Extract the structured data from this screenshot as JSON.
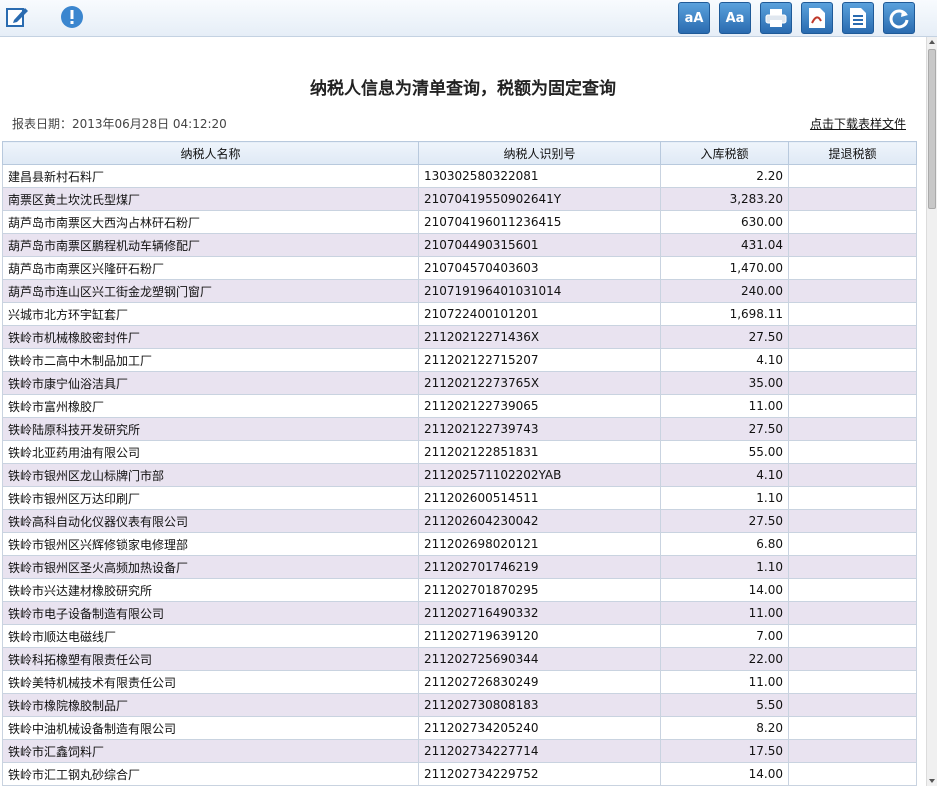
{
  "toolbar": {
    "left_icons": [
      "edit-icon",
      "alert-icon"
    ],
    "right_icons": [
      "font-larger-icon",
      "font-smaller-icon",
      "print-icon",
      "export-pdf-icon",
      "export-sheet-icon",
      "refresh-icon"
    ],
    "font_larger_glyph": "aA",
    "font_smaller_glyph": "Aa"
  },
  "report": {
    "title": "纳税人信息为清单查询，税额为固定查询",
    "date_label": "报表日期：2013年06月28日 04:12:20",
    "download_link": "点击下载表样文件"
  },
  "table": {
    "headers": [
      "纳税人名称",
      "纳税人识别号",
      "入库税额",
      "提退税额"
    ],
    "rows": [
      [
        "建昌县新村石料厂",
        "130302580322081",
        "2.20",
        ""
      ],
      [
        "南票区黄土坎沈氏型煤厂",
        "21070419550902641Y",
        "3,283.20",
        ""
      ],
      [
        "葫芦岛市南票区大西沟占林矸石粉厂",
        "210704196011236415",
        "630.00",
        ""
      ],
      [
        "葫芦岛市南票区鹏程机动车辆修配厂",
        "210704490315601",
        "431.04",
        ""
      ],
      [
        "葫芦岛市南票区兴隆矸石粉厂",
        "210704570403603",
        "1,470.00",
        ""
      ],
      [
        "葫芦岛市连山区兴工街金龙塑钢门窗厂",
        "210719196401031014",
        "240.00",
        ""
      ],
      [
        "兴城市北方环宇缸套厂",
        "210722400101201",
        "1,698.11",
        ""
      ],
      [
        "铁岭市机械橡胶密封件厂",
        "21120212271436X",
        "27.50",
        ""
      ],
      [
        "铁岭市二高中木制品加工厂",
        "211202122715207",
        "4.10",
        ""
      ],
      [
        "铁岭市康宁仙浴洁具厂",
        "21120212273765X",
        "35.00",
        ""
      ],
      [
        "铁岭市富州橡胶厂",
        "211202122739065",
        "11.00",
        ""
      ],
      [
        "铁岭陆原科技开发研究所",
        "211202122739743",
        "27.50",
        ""
      ],
      [
        "铁岭北亚药用油有限公司",
        "211202122851831",
        "55.00",
        ""
      ],
      [
        "铁岭市银州区龙山标牌门市部",
        "211202571102202YAB",
        "4.10",
        ""
      ],
      [
        "铁岭市银州区万达印刷厂",
        "211202600514511",
        "1.10",
        ""
      ],
      [
        "铁岭高科自动化仪器仪表有限公司",
        "211202604230042",
        "27.50",
        ""
      ],
      [
        "铁岭市银州区兴辉修锁家电修理部",
        "211202698020121",
        "6.80",
        ""
      ],
      [
        "铁岭市银州区圣火高频加热设备厂",
        "211202701746219",
        "1.10",
        ""
      ],
      [
        "铁岭市兴达建材橡胶研究所",
        "211202701870295",
        "14.00",
        ""
      ],
      [
        "铁岭市电子设备制造有限公司",
        "211202716490332",
        "11.00",
        ""
      ],
      [
        "铁岭市顺达电磁线厂",
        "211202719639120",
        "7.00",
        ""
      ],
      [
        "铁岭科拓橡塑有限责任公司",
        "211202725690344",
        "22.00",
        ""
      ],
      [
        "铁岭美特机械技术有限责任公司",
        "211202726830249",
        "11.00",
        ""
      ],
      [
        "铁岭市橡院橡胶制品厂",
        "211202730808183",
        "5.50",
        ""
      ],
      [
        "铁岭中油机械设备制造有限公司",
        "211202734205240",
        "8.20",
        ""
      ],
      [
        "铁岭市汇鑫饲料厂",
        "211202734227714",
        "17.50",
        ""
      ],
      [
        "铁岭市汇工钢丸砂综合厂",
        "211202734229752",
        "14.00",
        ""
      ]
    ]
  }
}
